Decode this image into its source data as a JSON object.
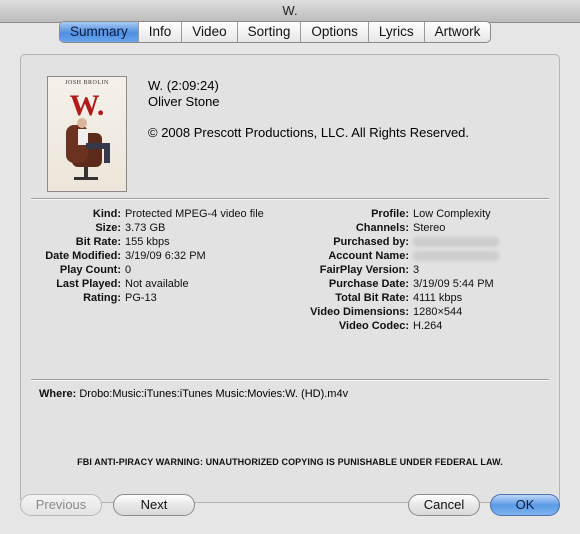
{
  "window": {
    "title": "W."
  },
  "tabs": [
    {
      "label": "Summary",
      "active": true
    },
    {
      "label": "Info"
    },
    {
      "label": "Video"
    },
    {
      "label": "Sorting"
    },
    {
      "label": "Options"
    },
    {
      "label": "Lyrics"
    },
    {
      "label": "Artwork"
    }
  ],
  "poster": {
    "actor": "JOSH BROLIN",
    "title": "W."
  },
  "header": {
    "title_line": "W. (2:09:24)",
    "director": "Oliver Stone",
    "copyright": "© 2008 Prescott Productions, LLC. All Rights Reserved."
  },
  "details_left": [
    {
      "label": "Kind:",
      "value": "Protected MPEG-4 video file"
    },
    {
      "label": "Size:",
      "value": "3.73 GB"
    },
    {
      "label": "Bit Rate:",
      "value": "155 kbps"
    },
    {
      "label": "Date Modified:",
      "value": "3/19/09 6:32 PM"
    },
    {
      "label": "Play Count:",
      "value": "0"
    },
    {
      "label": "Last Played:",
      "value": "Not available"
    },
    {
      "label": "Rating:",
      "value": "PG-13"
    }
  ],
  "details_right": [
    {
      "label": "Profile:",
      "value": "Low Complexity"
    },
    {
      "label": "Channels:",
      "value": "Stereo"
    },
    {
      "label": "Purchased by:",
      "value": ""
    },
    {
      "label": "Account Name:",
      "value": ""
    },
    {
      "label": "FairPlay Version:",
      "value": "3"
    },
    {
      "label": "Purchase Date:",
      "value": "3/19/09 5:44 PM"
    },
    {
      "label": "Total Bit Rate:",
      "value": "4111 kbps"
    },
    {
      "label": "Video Dimensions:",
      "value": "1280×544"
    },
    {
      "label": "Video Codec:",
      "value": "H.264"
    }
  ],
  "where": {
    "label": "Where:",
    "value": "Drobo:Music:iTunes:iTunes Music:Movies:W. (HD).m4v"
  },
  "warning": "FBI ANTI-PIRACY WARNING: UNAUTHORIZED COPYING IS PUNISHABLE UNDER FEDERAL LAW.",
  "buttons": {
    "previous": "Previous",
    "next": "Next",
    "cancel": "Cancel",
    "ok": "OK"
  }
}
